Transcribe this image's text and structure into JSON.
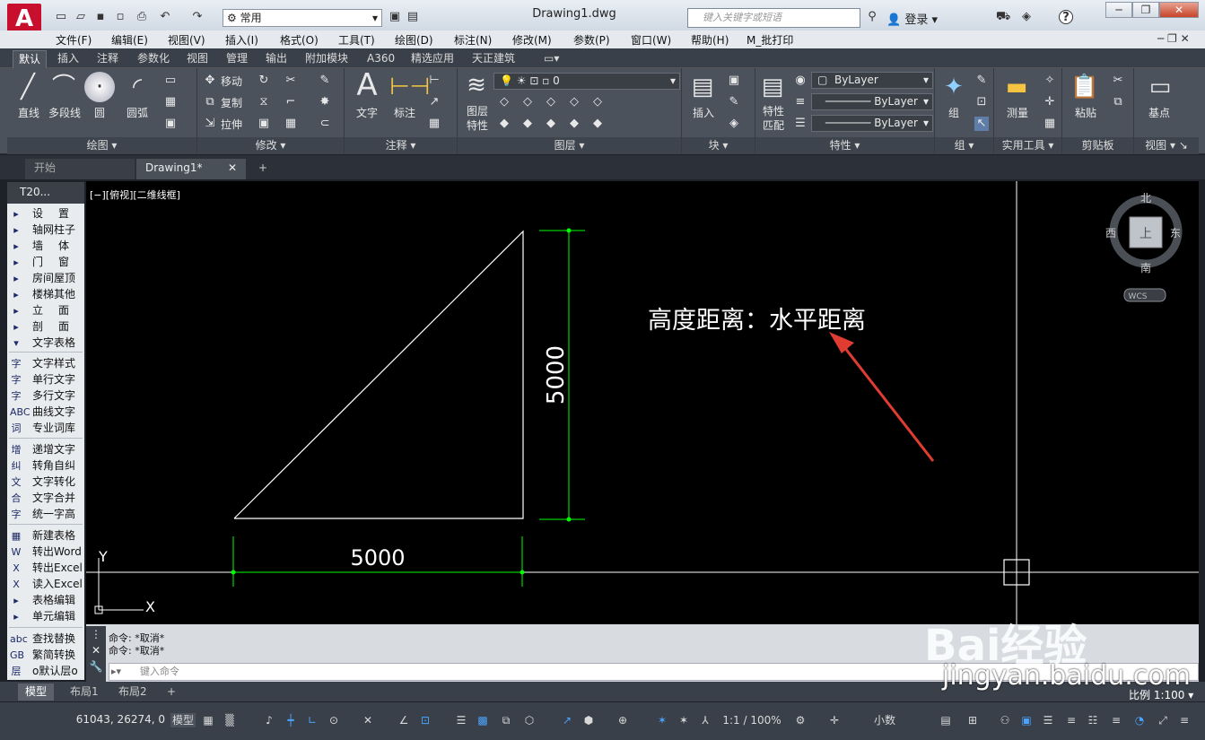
{
  "title_bar": {
    "logo": "A",
    "workspace": "常用",
    "document_title": "Drawing1.dwg",
    "search_placeholder": "键入关键字或短语",
    "login": "登录",
    "help": "?",
    "win_minimize": "─",
    "win_restore": "❐",
    "win_close": "✕"
  },
  "menu": [
    "文件(F)",
    "编辑(E)",
    "视图(V)",
    "插入(I)",
    "格式(O)",
    "工具(T)",
    "绘图(D)",
    "标注(N)",
    "修改(M)",
    "参数(P)",
    "窗口(W)",
    "帮助(H)",
    "M_批打印"
  ],
  "ribbon_tabs": [
    "默认",
    "插入",
    "注释",
    "参数化",
    "视图",
    "管理",
    "输出",
    "附加模块",
    "A360",
    "精选应用",
    "天正建筑"
  ],
  "ribbon": {
    "draw": {
      "title": "绘图",
      "line": "直线",
      "polyline": "多段线",
      "circle": "圆",
      "arc": "圆弧"
    },
    "modify": {
      "title": "修改",
      "move": "移动",
      "copy": "复制",
      "stretch": "拉伸"
    },
    "annotation": {
      "title": "注释",
      "text": "文字",
      "dimension": "标注"
    },
    "layers": {
      "title": "图层",
      "layer_props": "图层\n特性",
      "current_layer": "0"
    },
    "block": {
      "title": "块",
      "insert": "插入"
    },
    "properties": {
      "title": "特性",
      "match": "特性\n匹配",
      "color": "ByLayer",
      "linetype": "ByLayer",
      "lineweight": "ByLayer"
    },
    "groups": {
      "title": "组",
      "group": "组"
    },
    "utilities": {
      "title": "实用工具",
      "measure": "测量"
    },
    "clipboard": {
      "title": "剪贴板",
      "paste": "粘贴"
    },
    "view": {
      "title": "视图",
      "basepoint": "基点"
    }
  },
  "doc_tabs": [
    {
      "label": "开始"
    },
    {
      "label": "Drawing1*"
    }
  ],
  "palette": {
    "header": "T20...",
    "menu": [
      "设置",
      "轴网柱子",
      "墙体",
      "门窗",
      "房间屋顶",
      "楼梯其他",
      "立面",
      "剖面",
      "文字表格"
    ],
    "group1": [
      {
        "label": "文字样式",
        "icon": "字"
      },
      {
        "label": "单行文字",
        "icon": "字"
      },
      {
        "label": "多行文字",
        "icon": "字"
      },
      {
        "label": "曲线文字",
        "icon": "ABC"
      },
      {
        "label": "专业词库",
        "icon": "词"
      }
    ],
    "group2": [
      {
        "label": "递增文字",
        "icon": "增"
      },
      {
        "label": "转角自纠",
        "icon": "纠"
      },
      {
        "label": "文字转化",
        "icon": "文"
      },
      {
        "label": "文字合并",
        "icon": "合"
      },
      {
        "label": "统一字高",
        "icon": "字"
      }
    ],
    "group3": [
      {
        "label": "新建表格",
        "icon": "▦"
      },
      {
        "label": "转出Word",
        "icon": "W"
      },
      {
        "label": "转出Excel",
        "icon": "X"
      },
      {
        "label": "读入Excel",
        "icon": "X"
      },
      {
        "label": "表格编辑",
        "icon": "▸"
      },
      {
        "label": "单元编辑",
        "icon": "▸"
      }
    ],
    "group4": [
      {
        "label": "查找替换",
        "icon": "abc"
      },
      {
        "label": "繁简转换",
        "icon": "GB"
      },
      {
        "label": "o默认层o",
        "icon": "层"
      }
    ]
  },
  "viewport": {
    "label": "[−][俯视][二维线框]",
    "dim_vertical": "5000",
    "dim_horizontal": "5000",
    "annotation": "高度距离：水平距离",
    "ucs_y": "Y",
    "ucs_x": "X"
  },
  "viewcube": {
    "north": "北",
    "south": "南",
    "east": "东",
    "west": "西",
    "top": "上",
    "wcs": "WCS"
  },
  "command": {
    "history": [
      "命令: *取消*",
      "命令: *取消*"
    ],
    "placeholder": "键入命令"
  },
  "layout_tabs": [
    "模型",
    "布局1",
    "布局2"
  ],
  "status": {
    "coords": "61043, 26274, 0",
    "model": "模型",
    "scale": "1:1 / 100%",
    "units": "小数",
    "plot_scale": "比例 1:100"
  },
  "watermark": {
    "brand": "Bai经验",
    "url": "jingyan.baidu.com"
  },
  "colors": {
    "accent": "#c8102e",
    "dimension": "#00ff00",
    "canvas": "#000000"
  }
}
